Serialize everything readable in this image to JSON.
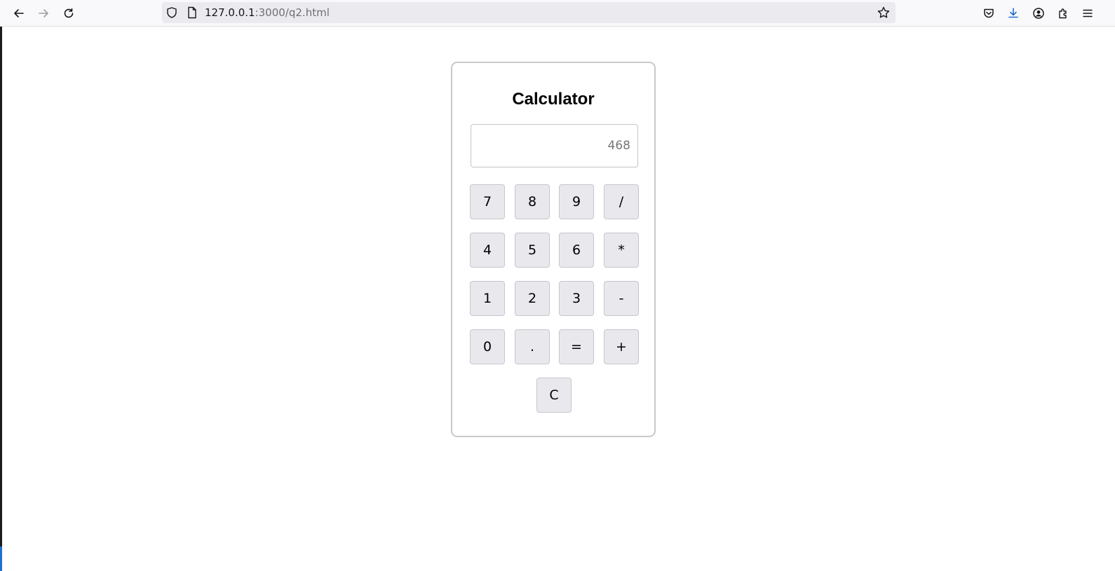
{
  "browser": {
    "url_host": "127.0.0.1",
    "url_path": ":3000/q2.html"
  },
  "calculator": {
    "title": "Calculator",
    "display_value": "468",
    "keys": [
      "7",
      "8",
      "9",
      "/",
      "4",
      "5",
      "6",
      "*",
      "1",
      "2",
      "3",
      "-",
      "0",
      ".",
      "=",
      "+",
      "C"
    ]
  }
}
